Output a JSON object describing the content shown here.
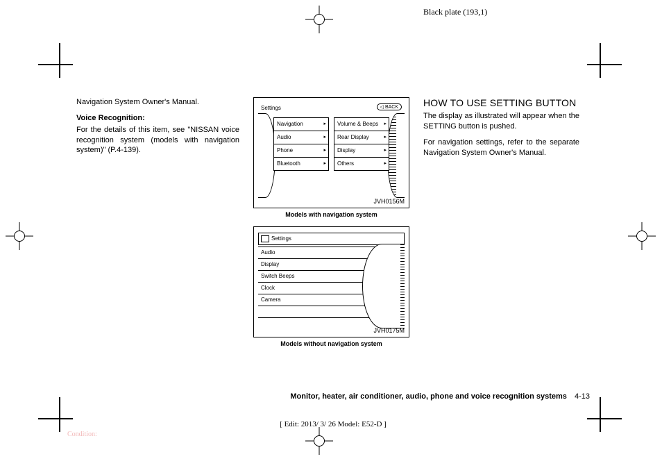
{
  "plate_label": "Black plate (193,1)",
  "col1": {
    "line1": "Navigation System Owner's Manual.",
    "voice_heading": "Voice Recognition:",
    "voice_body": "For the details of this item, see \"NISSAN voice recognition system (models with navigation system)\" (P.4-139)."
  },
  "fig1": {
    "settings": "Settings",
    "back": "BACK",
    "left_items": [
      "Navigation",
      "Audio",
      "Phone",
      "Bluetooth"
    ],
    "right_items": [
      "Volume & Beeps",
      "Rear Display",
      "Display",
      "Others"
    ],
    "id": "JVH0156M",
    "caption": "Models with navigation system"
  },
  "fig2": {
    "settings": "Settings",
    "items": [
      "Audio",
      "Display",
      "Switch Beeps",
      "Clock",
      "Camera"
    ],
    "id": "JVH0175M",
    "caption": "Models without navigation system"
  },
  "col3": {
    "heading": "HOW TO USE SETTING BUTTON",
    "p1": "The display as illustrated will appear when the SETTING button is pushed.",
    "p2": "For navigation settings, refer to the separate Navigation System Owner's Manual."
  },
  "footer": {
    "section": "Monitor, heater, air conditioner, audio, phone and voice recognition systems",
    "page": "4-13"
  },
  "edit_line": "[ Edit: 2013/ 3/ 26   Model: E52-D ]",
  "condition": "Condition:"
}
